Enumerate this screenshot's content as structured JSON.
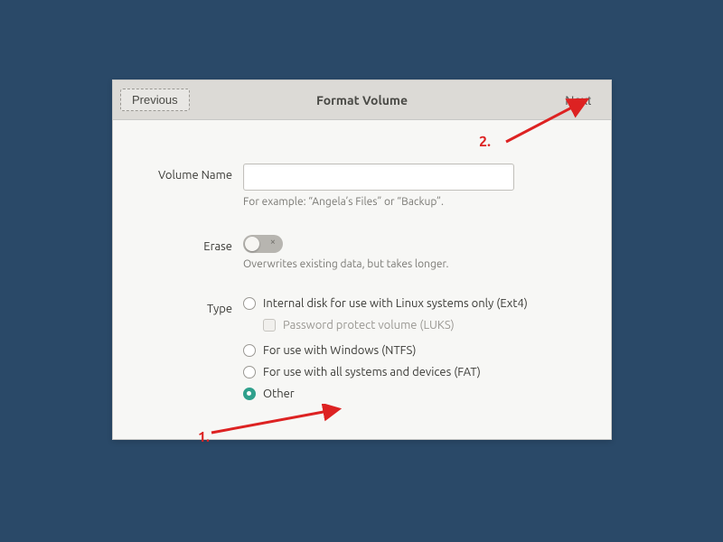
{
  "header": {
    "previous": "Previous",
    "title": "Format Volume",
    "next": "Next"
  },
  "form": {
    "volume_name": {
      "label": "Volume Name",
      "value": "",
      "hint": "For example: “Angela’s Files” or “Backup”."
    },
    "erase": {
      "label": "Erase",
      "on": false,
      "hint": "Overwrites existing data, but takes longer."
    },
    "type": {
      "label": "Type",
      "options": [
        {
          "key": "ext4",
          "label": "Internal disk for use with Linux systems only (Ext4)",
          "selected": false
        },
        {
          "key": "luks",
          "label": "Password protect volume (LUKS)",
          "is_sub_checkbox": true,
          "enabled": false,
          "checked": false
        },
        {
          "key": "ntfs",
          "label": "For use with Windows (NTFS)",
          "selected": false
        },
        {
          "key": "fat",
          "label": "For use with all systems and devices (FAT)",
          "selected": false
        },
        {
          "key": "other",
          "label": "Other",
          "selected": true
        }
      ]
    }
  },
  "annotations": {
    "step1": "1.",
    "step2": "2."
  }
}
